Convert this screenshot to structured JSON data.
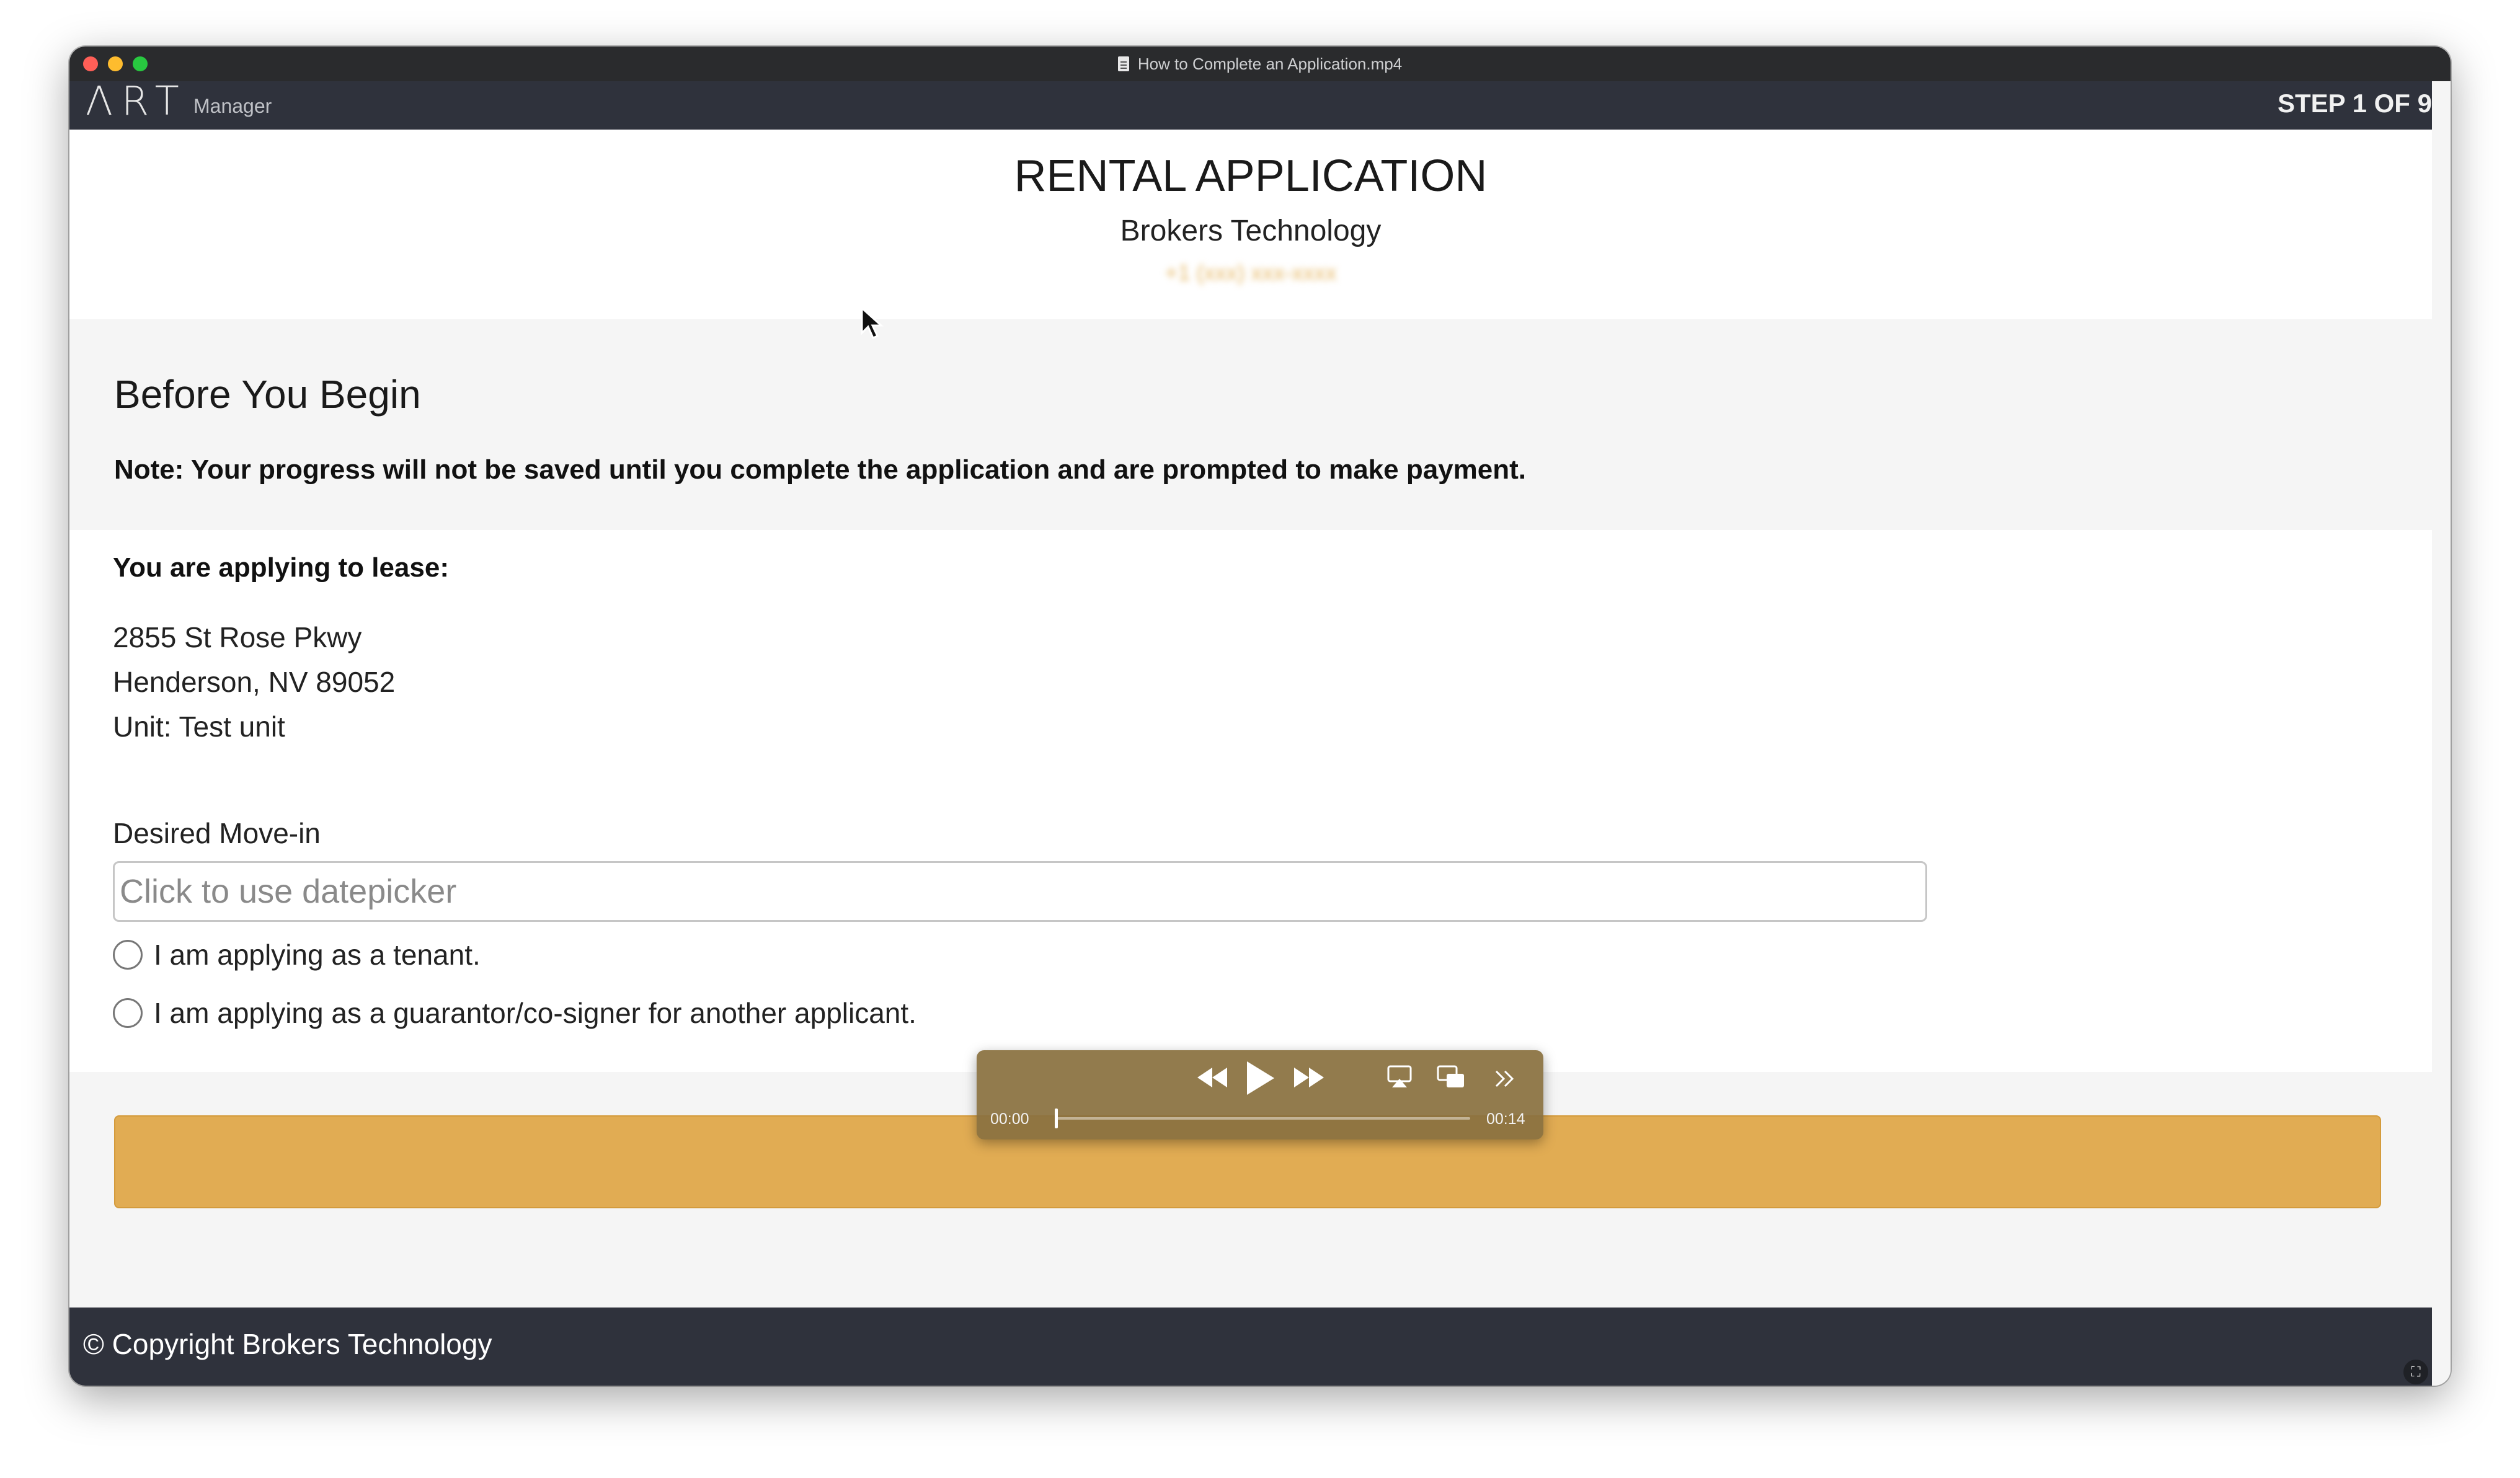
{
  "window": {
    "title": "How to Complete an Application.mp4"
  },
  "topnav": {
    "logo_mark": "ΛRT",
    "logo_sub": "Manager",
    "step": "STEP 1 OF 9"
  },
  "header": {
    "title": "RENTAL APPLICATION",
    "company": "Brokers Technology",
    "phone": "+1 (xxx) xxx-xxxx"
  },
  "before": {
    "heading": "Before You Begin",
    "note": "Note: Your progress will not be saved until you complete the application and are prompted to make payment."
  },
  "lease": {
    "heading": "You are applying to lease:",
    "address_line1": "2855 St Rose Pkwy",
    "address_line2": "Henderson, NV 89052",
    "unit": "Unit: Test unit",
    "movein_label": "Desired Move-in",
    "movein_placeholder": "Click to use datepicker",
    "options": [
      {
        "label": "I am applying as a tenant.",
        "selected": false
      },
      {
        "label": "I am applying as a guarantor/co-signer for another applicant.",
        "selected": false
      }
    ]
  },
  "footer": {
    "copyright": "© Copyright Brokers Technology"
  },
  "player": {
    "current_time": "00:00",
    "duration": "00:14",
    "progress": 0,
    "icons": [
      "rewind-icon",
      "play-icon",
      "fast-forward-icon",
      "airplay-icon",
      "picture-in-picture-icon",
      "more-icon"
    ]
  },
  "colors": {
    "nav_bg": "#2f323c",
    "accent_button": "#e1ac53",
    "section_bg": "#f5f5f5"
  }
}
